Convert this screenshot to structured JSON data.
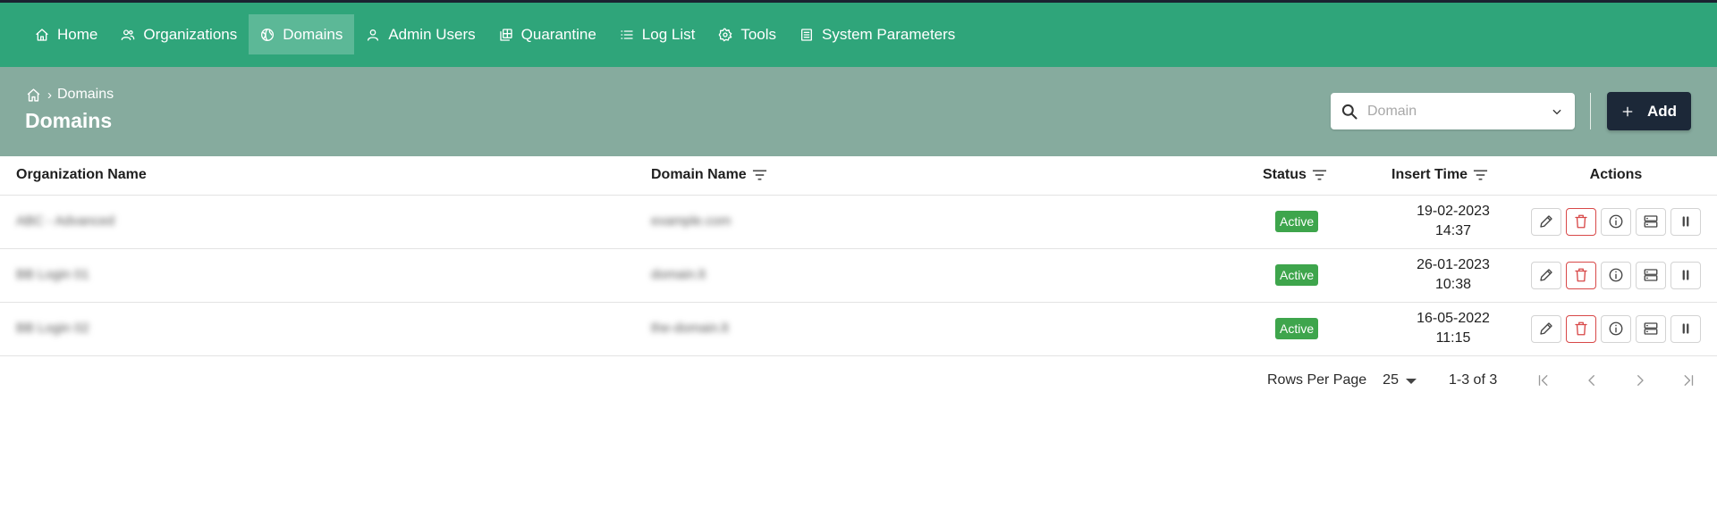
{
  "nav": {
    "items": [
      {
        "label": "Home",
        "icon": "home-icon"
      },
      {
        "label": "Organizations",
        "icon": "users-icon"
      },
      {
        "label": "Domains",
        "icon": "globe-icon",
        "active": true
      },
      {
        "label": "Admin Users",
        "icon": "user-icon"
      },
      {
        "label": "Quarantine",
        "icon": "quarantine-icon"
      },
      {
        "label": "Log List",
        "icon": "list-icon"
      },
      {
        "label": "Tools",
        "icon": "gear-icon"
      },
      {
        "label": "System Parameters",
        "icon": "document-icon"
      }
    ]
  },
  "header": {
    "breadcrumb_current": "Domains",
    "title": "Domains"
  },
  "search": {
    "placeholder": "Domain"
  },
  "toolbar": {
    "add_label": "Add"
  },
  "table": {
    "columns": {
      "org": "Organization Name",
      "domain": "Domain Name",
      "status": "Status",
      "time": "Insert Time",
      "actions": "Actions"
    },
    "rows": [
      {
        "org": "ABC - Advanced",
        "domain": "example.com",
        "status": "Active",
        "date": "19-02-2023",
        "time": "14:37"
      },
      {
        "org": "BB Login 01",
        "domain": "domain.lt",
        "status": "Active",
        "date": "26-01-2023",
        "time": "10:38"
      },
      {
        "org": "BB Login 02",
        "domain": "the-domain.lt",
        "status": "Active",
        "date": "16-05-2022",
        "time": "11:15"
      }
    ]
  },
  "pagination": {
    "rows_per_page_label": "Rows Per Page",
    "rows_per_page": "25",
    "range": "1-3 of 3"
  },
  "colors": {
    "topbar": "#2fa57a",
    "header": "#86ab9e",
    "add_button": "#1c2838",
    "status_active": "#3ea54c",
    "delete": "#d84848"
  }
}
